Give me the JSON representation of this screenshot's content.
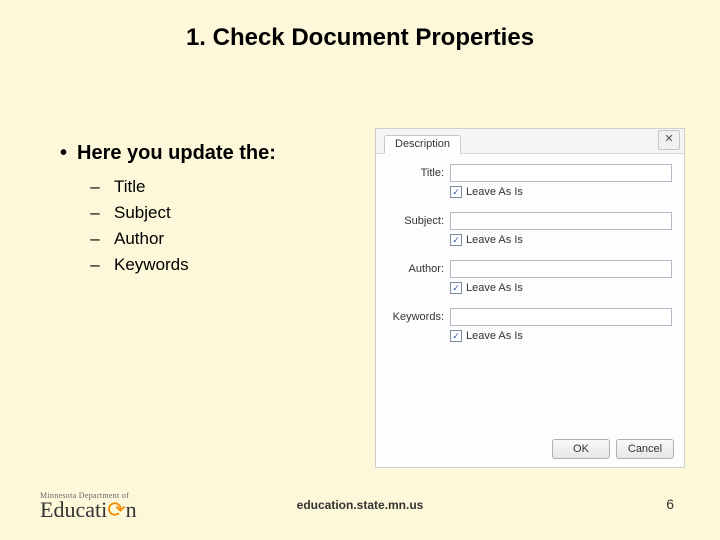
{
  "title": "1. Check Document Properties",
  "bullet1": "Here you update the:",
  "subitems": {
    "a": "Title",
    "b": "Subject",
    "c": "Author",
    "d": "Keywords"
  },
  "dialog": {
    "tab": "Description",
    "close_glyph": "✕",
    "fields": {
      "title_label": "Title:",
      "subject_label": "Subject:",
      "author_label": "Author:",
      "keywords_label": "Keywords:"
    },
    "leave_as_is": "Leave As Is",
    "check_glyph": "✓",
    "ok": "OK",
    "cancel": "Cancel"
  },
  "logo": {
    "top_a": "Minnesota",
    "top_b": "Department of",
    "brand_a": "Educati",
    "brand_b": "n",
    "accent_glyph": "⟳"
  },
  "footer_url": "education.state.mn.us",
  "page_number": "6"
}
